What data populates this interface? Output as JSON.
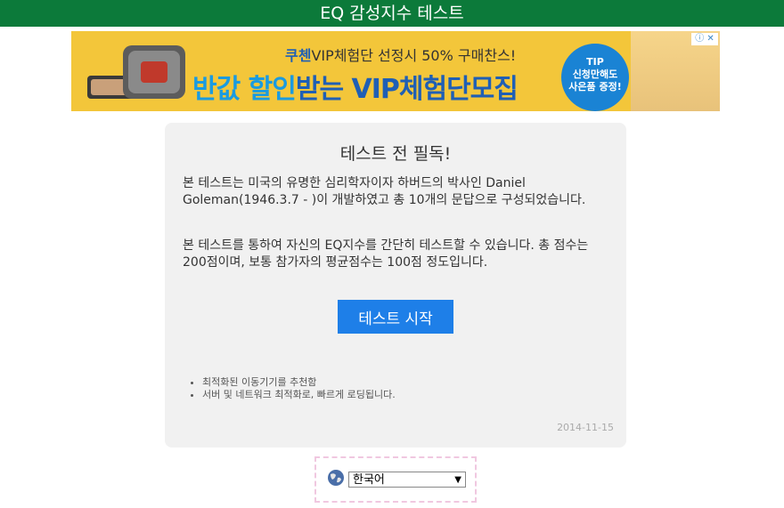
{
  "header": {
    "title": "EQ 감성지수 테스트"
  },
  "ad": {
    "top_line_brand": "쿠첸",
    "top_line_rest": "VIP체험단 선정시 50% 구매찬스!",
    "main_line_accent": "반값 할인",
    "main_line_rest": "받는 VIP체험단모집",
    "tip_title": "TIP",
    "tip_line1": "신청만해도",
    "tip_line2": "사은품 증정!",
    "info_label": "ⓘ ✕"
  },
  "card": {
    "title": "테스트 전 필독!",
    "paragraph1": "본 테스트는 미국의 유명한 심리학자이자 하버드의 박사인 Daniel Goleman(1946.3.7 - )이 개발하였고 총 10개의 문답으로 구성되었습니다.",
    "paragraph2": "본 테스트를 통하여 자신의 EQ지수를 간단히 테스트할 수 있습니다. 총 점수는 200점이며, 보통 참가자의 평균점수는 100점 정도입니다.",
    "start_button": "테스트 시작",
    "notes": [
      "최적화된 이동기기를 추천함",
      "서버 및 네트워크 최적화로, 빠르게 로딩됩니다."
    ],
    "date": "2014-11-15"
  },
  "language": {
    "selected": "한국어",
    "icon": "globe-icon"
  },
  "colors": {
    "header_bg": "#0c7a3a",
    "button_bg": "#1e7fe8",
    "card_bg": "#f1f1f1",
    "ad_bg": "#f3c63a"
  }
}
